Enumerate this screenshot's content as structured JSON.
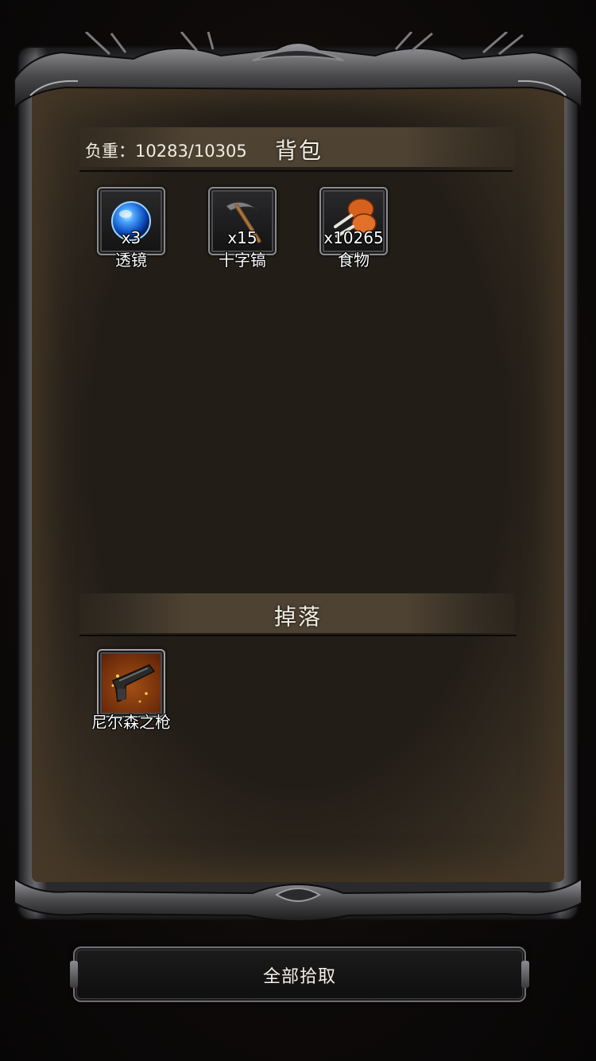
{
  "backpack": {
    "weight_text": "负重：10283/10305",
    "title": "背包",
    "items": [
      {
        "name": "透镜",
        "qty": "x3",
        "icon": "blue-orb-icon"
      },
      {
        "name": "十字镐",
        "qty": "x15",
        "icon": "pickaxe-icon"
      },
      {
        "name": "食物",
        "qty": "x10265",
        "icon": "meat-icon"
      }
    ]
  },
  "drops": {
    "title": "掉落",
    "items": [
      {
        "name": "尼尔森之枪",
        "qty": "",
        "icon": "gun-icon"
      }
    ]
  },
  "actions": {
    "pick_all_label": "全部拾取"
  },
  "colors": {
    "background": "#0a0807",
    "parchment": "#221d17",
    "text": "#f4efe3",
    "rare_slot": "#a24f14"
  }
}
